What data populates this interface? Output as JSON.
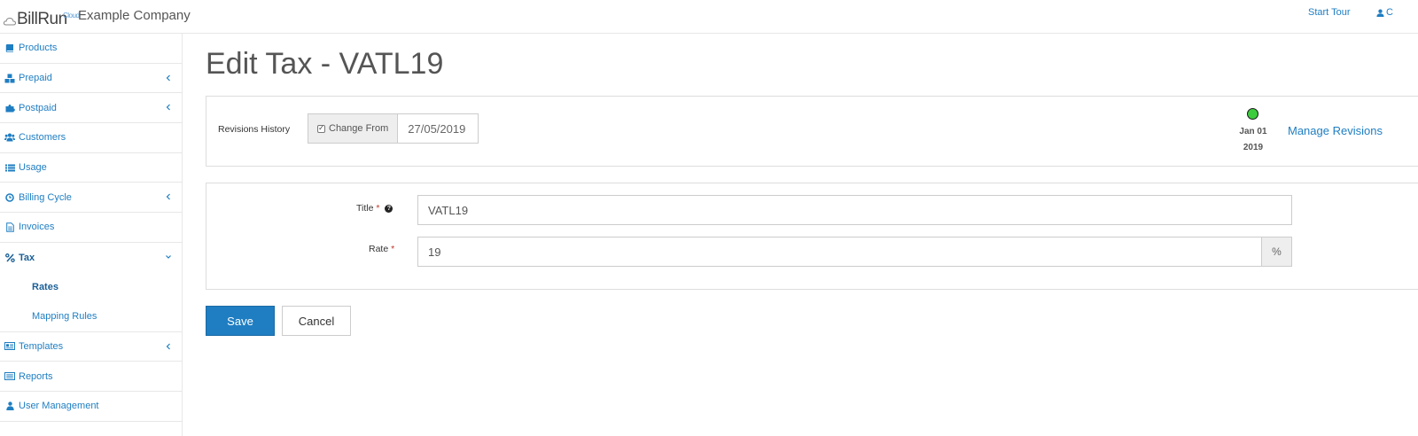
{
  "brand": {
    "logo_text": "BillRun",
    "logo_superscript": "Cloud",
    "company": "Example Company"
  },
  "topbar": {
    "start_tour": "Start Tour",
    "user_initial": "C"
  },
  "sidebar": {
    "items": [
      {
        "label": "Products",
        "icon": "book-icon"
      },
      {
        "label": "Prepaid",
        "icon": "cubes-icon"
      },
      {
        "label": "Postpaid",
        "icon": "puzzle-icon"
      },
      {
        "label": "Customers",
        "icon": "users-icon"
      },
      {
        "label": "Usage",
        "icon": "list-icon"
      },
      {
        "label": "Billing Cycle",
        "icon": "clock-icon"
      },
      {
        "label": "Invoices",
        "icon": "file-icon"
      },
      {
        "label": "Tax",
        "icon": "percent-icon"
      },
      {
        "label": "Templates",
        "icon": "card-icon"
      },
      {
        "label": "Reports",
        "icon": "report-icon"
      },
      {
        "label": "User Management",
        "icon": "user-icon"
      }
    ],
    "tax_sub": [
      {
        "label": "Rates"
      },
      {
        "label": "Mapping Rules"
      }
    ]
  },
  "page": {
    "title": "Edit Tax - VATL19"
  },
  "revisions": {
    "label": "Revisions History",
    "change_from_label": "Change From",
    "change_from_checked": true,
    "change_from_date": "27/05/2019",
    "month": "Jan 01",
    "year": "2019",
    "status_color": "#3dcc3d",
    "manage_label": "Manage Revisions"
  },
  "form": {
    "title_label": "Title",
    "title_value": "VATL19",
    "rate_label": "Rate",
    "rate_value": "19",
    "rate_unit": "%",
    "required_mark": "*",
    "help_mark": "?"
  },
  "actions": {
    "save": "Save",
    "cancel": "Cancel"
  },
  "colors": {
    "accent": "#1f7ec2",
    "required": "#c0392b"
  }
}
